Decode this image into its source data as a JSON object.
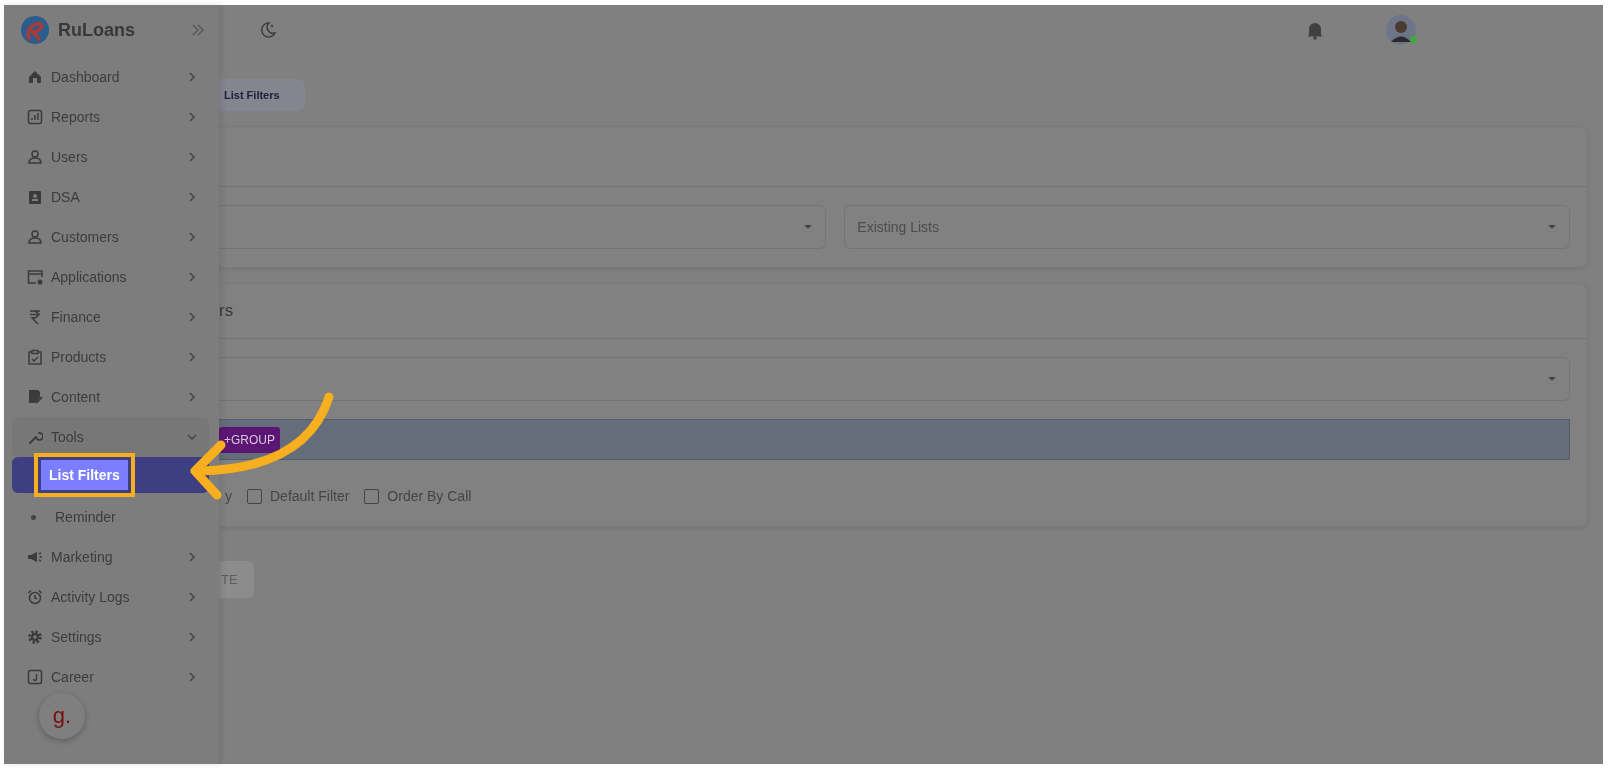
{
  "app": {
    "name": "RuLoans"
  },
  "sidebar": {
    "items": [
      {
        "label": "Dashboard",
        "expanded": false
      },
      {
        "label": "Reports",
        "expanded": false
      },
      {
        "label": "Users",
        "expanded": false
      },
      {
        "label": "DSA",
        "expanded": false
      },
      {
        "label": "Customers",
        "expanded": false
      },
      {
        "label": "Applications",
        "expanded": false
      },
      {
        "label": "Finance",
        "expanded": false
      },
      {
        "label": "Products",
        "expanded": false
      },
      {
        "label": "Content",
        "expanded": false
      },
      {
        "label": "Tools",
        "expanded": true,
        "children": [
          {
            "label": "List Filters",
            "selected": true
          },
          {
            "label": "Reminder",
            "selected": false
          }
        ]
      },
      {
        "label": "Marketing",
        "expanded": false
      },
      {
        "label": "Activity Logs",
        "expanded": false
      },
      {
        "label": "Settings",
        "expanded": false
      },
      {
        "label": "Career",
        "expanded": false
      }
    ]
  },
  "breadcrumb": "List Filters",
  "list_card": {
    "selects": [
      {
        "placeholder": "Existing Lists"
      }
    ]
  },
  "filter_card": {
    "title": "rs",
    "group_button": "+GROUP",
    "checkboxes": [
      {
        "label": "y"
      },
      {
        "label": "Default Filter",
        "checked": false
      },
      {
        "label": "Order By Call",
        "checked": false
      }
    ],
    "submit": {
      "label": "TE",
      "disabled": true
    }
  },
  "widget": {
    "label": "g."
  }
}
